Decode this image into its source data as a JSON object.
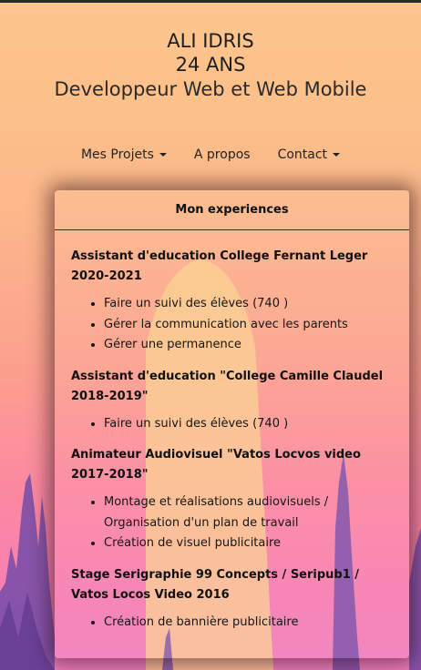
{
  "header": {
    "name": "ALI IDRIS",
    "age": "24 ANS",
    "role": "Developpeur Web et Web Mobile"
  },
  "nav": [
    {
      "label": "Mes Projets",
      "dropdown": true
    },
    {
      "label": "A propos",
      "dropdown": false
    },
    {
      "label": "Contact",
      "dropdown": true
    }
  ],
  "card": {
    "title": "Mon experiences",
    "jobs": [
      {
        "title": "Assistant d'education College Fernant Leger 2020-2021",
        "items": [
          "Faire un suivi des élèves (740 )",
          "Gérer la communication avec les parents",
          "Gérer une permanence"
        ]
      },
      {
        "title": "Assistant d'education \"College Camille Claudel 2018-2019\"",
        "items": [
          "Faire un suivi des élèves (740 )"
        ]
      },
      {
        "title": "Animateur Audiovisuel \"Vatos Locvos video 2017-2018\"",
        "items": [
          "Montage et réalisations audiovisuels / Organisation d'un plan de travail",
          "Création de visuel publicitaire"
        ]
      },
      {
        "title": "Stage Serigraphie 99 Concepts / Seripub1 / Vatos Locos Video 2016",
        "items": [
          "Création de bannière publicitaire"
        ]
      }
    ]
  },
  "colors": {
    "background_top": "#fdc68c",
    "background_bottom": "#f17fbd",
    "mountain": "#7b4fa8",
    "beam": "#fbd08e"
  }
}
